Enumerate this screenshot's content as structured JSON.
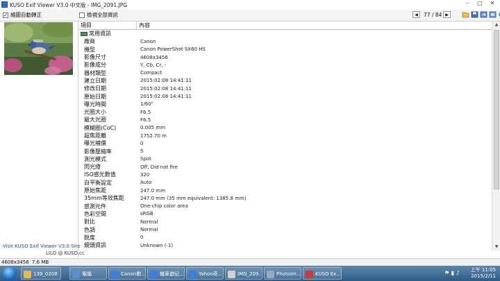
{
  "window": {
    "title": "KUSO Exif Viewer V3.0 中文版 - IMG_2091.JPG",
    "controls": {
      "minimize": "–",
      "maximize": "□",
      "close": "✕"
    }
  },
  "toolbar": {
    "auto_rotate_label": "縮圖自動轉正",
    "auto_rotate_checked": true,
    "show_all_label": "檢視全部資訊",
    "show_all_checked": false,
    "prev_symbol": "◀",
    "next_symbol": "▶",
    "counter": "77 / 84",
    "icons": [
      "open-folder-icon",
      "save-icon",
      "export-icon",
      "settings-icon",
      "info-icon"
    ]
  },
  "left_pane": {
    "visit_text": "Visit KUSO Exif Viewer V3.0 Site",
    "lilo_text": "LILO @ KUSO.cc"
  },
  "table": {
    "headers": [
      "項目",
      "內容"
    ],
    "group_label": "常用資訊",
    "rows": [
      {
        "name": "廠商",
        "value": "Canon"
      },
      {
        "name": "機型",
        "value": "Canon PowerShot SX60 HS"
      },
      {
        "name": "影像尺寸",
        "value": "4608x3456"
      },
      {
        "name": "影像成分",
        "value": "Y, Cb, Cr, -"
      },
      {
        "name": "器材類型",
        "value": "Compact"
      },
      {
        "name": "建立日期",
        "value": "2015:02:08 14:41:11"
      },
      {
        "name": "修改日期",
        "value": "2015:02:08 14:41:11"
      },
      {
        "name": "原始日期",
        "value": "2015:02:08 14:41:11"
      },
      {
        "name": "曝光時間",
        "value": "1/60\""
      },
      {
        "name": "光圈大小",
        "value": "F6.5"
      },
      {
        "name": "最大光圈",
        "value": "F6.5"
      },
      {
        "name": "模糊圈(CoC)",
        "value": "0.005 mm"
      },
      {
        "name": "超焦距離",
        "value": "1752.70 m"
      },
      {
        "name": "曝光補償",
        "value": "0"
      },
      {
        "name": "影像壓縮率",
        "value": "5"
      },
      {
        "name": "測光模式",
        "value": "Spot"
      },
      {
        "name": "閃光燈",
        "value": "Off, Did not fire"
      },
      {
        "name": "ISO感光數值",
        "value": "320"
      },
      {
        "name": "白平衡設定",
        "value": "Auto"
      },
      {
        "name": "原始焦距",
        "value": "247.0 mm"
      },
      {
        "name": "35mm等效焦距",
        "value": "247.0 mm (35 mm equivalent: 1385.8 mm)"
      },
      {
        "name": "感測元件",
        "value": "One-chip color area"
      },
      {
        "name": "色彩空間",
        "value": "sRGB"
      },
      {
        "name": "對比",
        "value": "Normal"
      },
      {
        "name": "色調",
        "value": "Normal"
      },
      {
        "name": "銳度",
        "value": "0"
      },
      {
        "name": "鏡頭資訊",
        "value": "Unknown (-1)"
      }
    ]
  },
  "statusbar": {
    "dimensions": "4608x3456",
    "filesize": "7.6 MB"
  },
  "taskbar": {
    "items": [
      {
        "label": "139_0208",
        "color": "#e8b84a"
      },
      {
        "label": "電腦",
        "color": "#5b8fd0"
      },
      {
        "label": "Canon數...",
        "color": "#3a7fd9"
      },
      {
        "label": "機車遊記...",
        "color": "#3a7fd9"
      },
      {
        "label": "Yahoo奇...",
        "color": "#3a7fd9"
      },
      {
        "label": "IMG_209...",
        "color": "#d0d0d0"
      },
      {
        "label": "PhotoIm...",
        "color": "#9aa8b8"
      },
      {
        "label": "KUSO Ex...",
        "color": "#c73b3b"
      }
    ],
    "time": "上午 11:05",
    "date": "2015/2/11"
  },
  "colors": {
    "accent": "#1d4fb0",
    "taskbar": "#2f5c86"
  }
}
